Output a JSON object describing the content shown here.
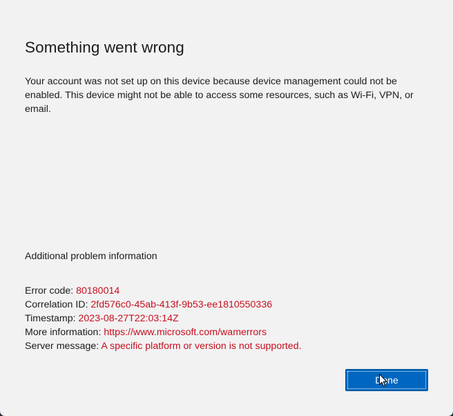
{
  "dialog": {
    "title": "Something went wrong",
    "description": "Your account was not set up on this device because device management could not be enabled. This device might not be able to access some resources, such as Wi-Fi, VPN, or email.",
    "additional_heading": "Additional problem information",
    "details": [
      {
        "label": "Error code: ",
        "value": "80180014"
      },
      {
        "label": "Correlation ID: ",
        "value": "2fd576c0-45ab-413f-9b53-ee1810550336"
      },
      {
        "label": "Timestamp: ",
        "value": "2023-08-27T22:03:14Z"
      },
      {
        "label": "More information: ",
        "value": "https://www.microsoft.com/wamerrors"
      },
      {
        "label": "Server message: ",
        "value": "A specific platform or version is not supported."
      }
    ],
    "done_label": "Done"
  },
  "colors": {
    "background": "#f2f2f2",
    "error_text": "#c50f1f",
    "accent": "#0067c0"
  },
  "icons": {
    "cursor": "mouse-pointer-icon"
  }
}
